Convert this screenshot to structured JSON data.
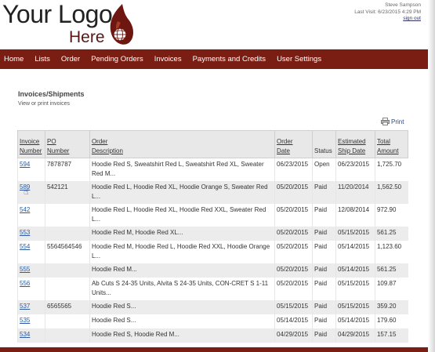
{
  "header": {
    "logo_line1": "Your Logo",
    "logo_line2": "Here",
    "user_name": "Steve Sampson",
    "last_visit": "Last Visit: 6/23/2015 4:29 PM",
    "sign_out": "sign out"
  },
  "nav": [
    "Home",
    "Lists",
    "Order",
    "Pending Orders",
    "Invoices",
    "Payments and Credits",
    "User Settings"
  ],
  "page": {
    "title": "Invoices/Shipments",
    "subtitle": "View or print invoices",
    "print_label": "Print"
  },
  "table": {
    "headers": {
      "invoice": [
        "Invoice",
        "Number"
      ],
      "po": [
        "PO",
        "Number"
      ],
      "desc": [
        "Order",
        "Description"
      ],
      "date": [
        "Order",
        "Date"
      ],
      "status": [
        "Status"
      ],
      "ship": [
        "Estimated",
        "Ship Date"
      ],
      "total": [
        "Total",
        "Amount"
      ]
    },
    "rows": [
      {
        "invoice": "594",
        "po": "7878787",
        "desc": "Hoodie Red S, Sweatshirt Red L, Sweatshirt Red XL, Sweater Red M...",
        "date": "06/23/2015",
        "status": "Open",
        "ship": "06/23/2015",
        "total": "1,725.70"
      },
      {
        "invoice": "589",
        "po": "542121",
        "desc": "Hoodie Red L, Hoodie Red XL, Hoodie Orange S, Sweater Red L...",
        "date": "05/20/2015",
        "status": "Paid",
        "ship": "11/20/2014",
        "total": "1,562.50"
      },
      {
        "invoice": "542",
        "po": "",
        "desc": "Hoodie Red L, Hoodie Red XL, Hoodie Red XXL, Sweater Red L...",
        "date": "05/20/2015",
        "status": "Paid",
        "ship": "12/08/2014",
        "total": "972.90"
      },
      {
        "invoice": "553",
        "po": "",
        "desc": "Hoodie Red M, Hoodie Red XL...",
        "date": "05/20/2015",
        "status": "Paid",
        "ship": "05/15/2015",
        "total": "561.25"
      },
      {
        "invoice": "554",
        "po": "5564564546",
        "desc": "Hoodie Red M, Hoodie Red L, Hoodie Red XXL, Hoodie Orange L...",
        "date": "05/20/2015",
        "status": "Paid",
        "ship": "05/14/2015",
        "total": "1,123.60"
      },
      {
        "invoice": "555",
        "po": "",
        "desc": "Hoodie Red M...",
        "date": "05/20/2015",
        "status": "Paid",
        "ship": "05/14/2015",
        "total": "561.25"
      },
      {
        "invoice": "556",
        "po": "",
        "desc": "Ab Cuts S 24-35 Units, Alvita S 24-35 Units, CON-CRET S 1-11 Units...",
        "date": "05/20/2015",
        "status": "Paid",
        "ship": "05/15/2015",
        "total": "109.87"
      },
      {
        "invoice": "537",
        "po": "6565565",
        "desc": "Hoodie Red S...",
        "date": "05/15/2015",
        "status": "Paid",
        "ship": "05/15/2015",
        "total": "359.20"
      },
      {
        "invoice": "535",
        "po": "",
        "desc": "Hoodie Red S...",
        "date": "05/14/2015",
        "status": "Paid",
        "ship": "05/14/2015",
        "total": "179.60"
      },
      {
        "invoice": "534",
        "po": "",
        "desc": "Hoodie Red S, Hoodie Red M...",
        "date": "04/29/2015",
        "status": "Paid",
        "ship": "04/29/2015",
        "total": "157.15"
      }
    ]
  },
  "colors": {
    "brand": "#7a1d12",
    "link": "#2b5aa0",
    "row_alt": "#ececec"
  },
  "icons": {
    "print": "printer-icon",
    "logo": "flame-globe-icon",
    "cursor": "hand-cursor-icon"
  }
}
